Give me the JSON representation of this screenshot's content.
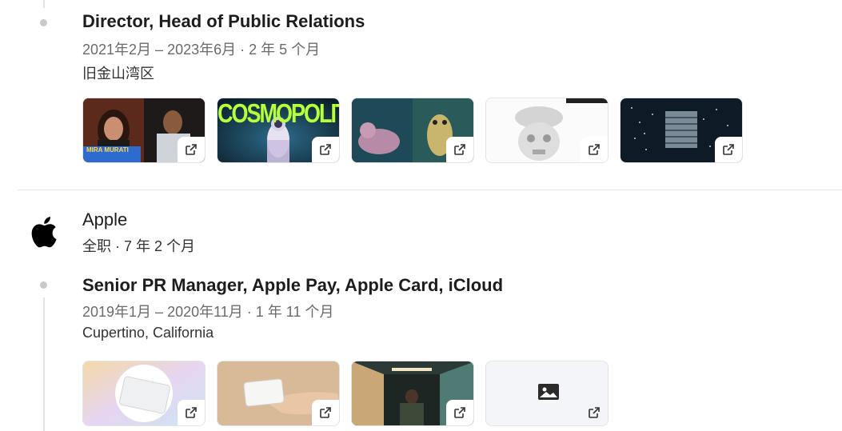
{
  "position1": {
    "title": "Director, Head of Public Relations",
    "dates": "2021年2月 – 2023年6月 · 2 年 5 个月",
    "location": "旧金山湾区",
    "thumbs": [
      {
        "caption": "MIRA MURATI"
      },
      {
        "caption": "COSMOPOLITAN"
      },
      {
        "caption": ""
      },
      {
        "caption": ""
      },
      {
        "caption": ""
      }
    ]
  },
  "company2": {
    "name": "Apple",
    "summary": "全职 · 7 年 2 个月"
  },
  "position2": {
    "title": "Senior PR Manager, Apple Pay, Apple Card, iCloud",
    "dates": "2019年1月 – 2020年11月 · 1 年 11 个月",
    "location": "Cupertino, California"
  },
  "icons": {
    "external_link": "external-link-icon",
    "company_logo": "apple-logo-icon",
    "image_placeholder": "image-icon"
  }
}
